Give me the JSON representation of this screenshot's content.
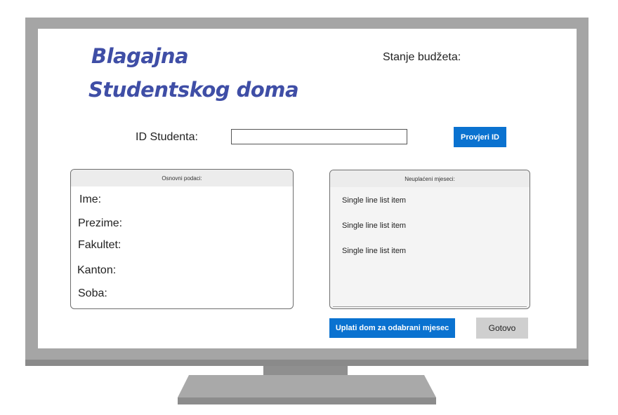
{
  "title": {
    "line1": "Blagajna",
    "line2": "Studentskog doma"
  },
  "budget": {
    "label": "Stanje budžeta:"
  },
  "student_id": {
    "label": "ID Studenta:",
    "value": "",
    "placeholder": "",
    "check_button": "Provjeri ID"
  },
  "basic_info": {
    "header": "Osnovni podaci:",
    "fields": {
      "name": "Ime:",
      "surname": "Prezime:",
      "faculty": "Fakultet:",
      "canton": "Kanton:",
      "room": "Soba:"
    }
  },
  "unpaid_months": {
    "header": "Neuplaćeni mjeseci:",
    "items": [
      "Single line list item",
      "Single line list item",
      "Single line list item"
    ]
  },
  "actions": {
    "pay": "Uplati dom za odabrani mjesec",
    "done": "Gotovo"
  },
  "colors": {
    "title": "#3f4ea6",
    "primary_button": "#0a72d0",
    "secondary_button": "#cfcfcf",
    "monitor_frame": "#a5a5a5"
  }
}
